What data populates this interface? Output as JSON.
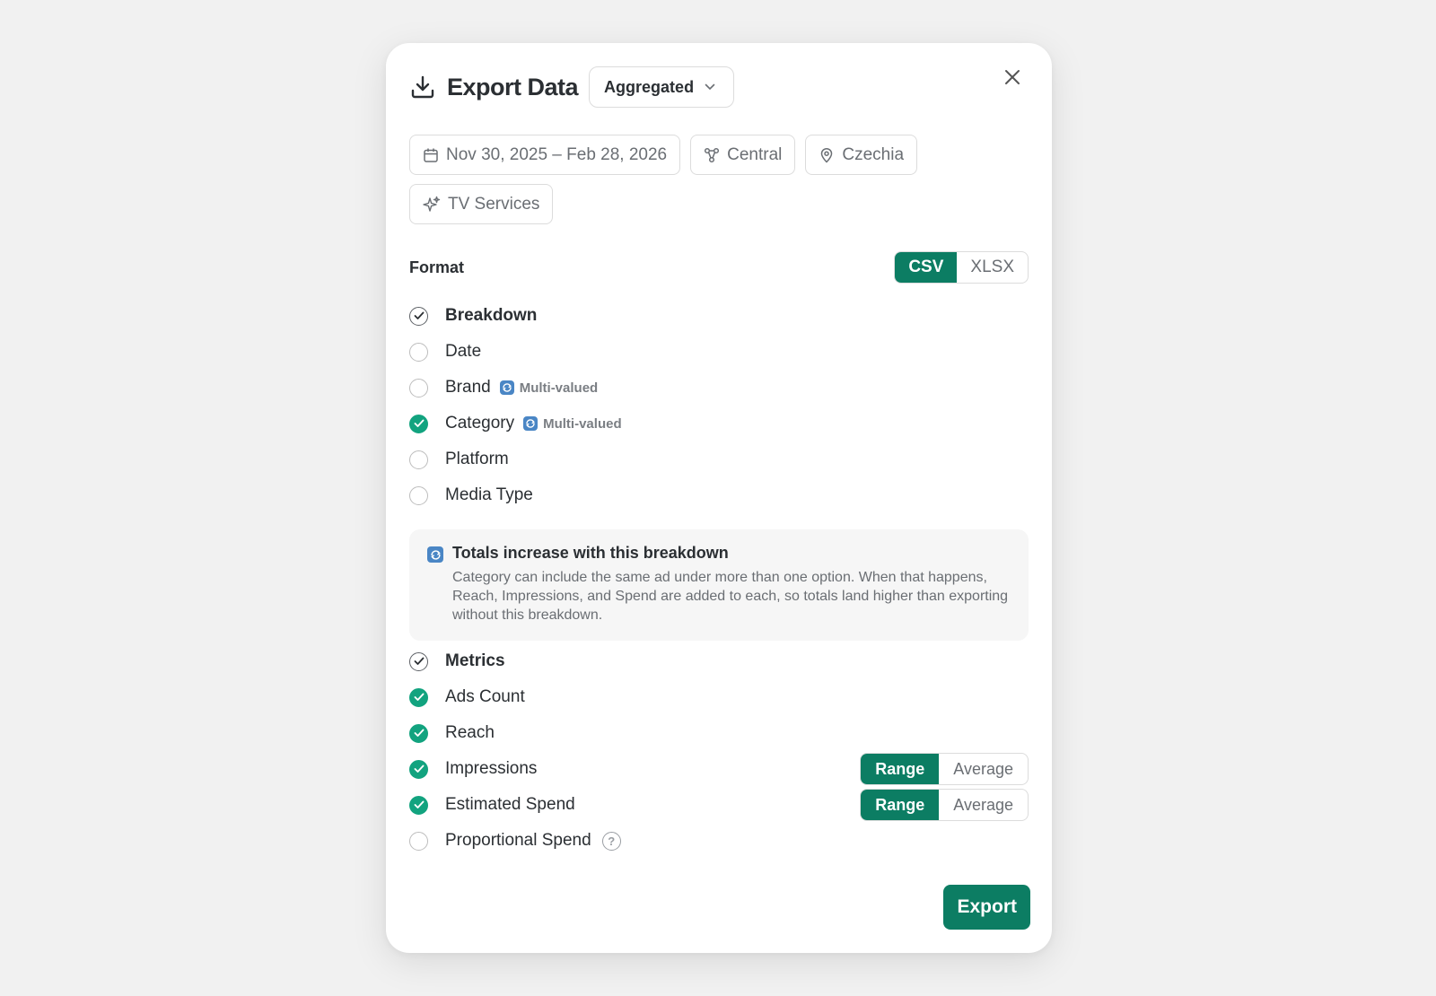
{
  "header": {
    "title": "Export Data",
    "mode_select": "Aggregated"
  },
  "filters": [
    {
      "icon": "calendar-icon",
      "label": "Nov 30, 2025 – Feb 28, 2026"
    },
    {
      "icon": "network-icon",
      "label": "Central"
    },
    {
      "icon": "location-pin-icon",
      "label": "Czechia"
    },
    {
      "icon": "sparkle-icon",
      "label": "TV Services"
    }
  ],
  "format": {
    "label": "Format",
    "options": [
      "CSV",
      "XLSX"
    ],
    "selected": "CSV"
  },
  "breakdown": {
    "label": "Breakdown",
    "items": [
      {
        "label": "Date",
        "checked": false,
        "multi_valued": false
      },
      {
        "label": "Brand",
        "checked": false,
        "multi_valued": true
      },
      {
        "label": "Category",
        "checked": true,
        "multi_valued": true
      },
      {
        "label": "Platform",
        "checked": false,
        "multi_valued": false
      },
      {
        "label": "Media Type",
        "checked": false,
        "multi_valued": false
      }
    ],
    "multi_valued_label": "Multi-valued"
  },
  "info": {
    "title": "Totals increase with this breakdown",
    "text": "Category can include the same ad under more than one option. When that happens, Reach, Impressions, and Spend are added to each, so totals land higher than exporting without this breakdown."
  },
  "metrics": {
    "label": "Metrics",
    "items": [
      {
        "label": "Ads Count",
        "checked": true
      },
      {
        "label": "Reach",
        "checked": true
      },
      {
        "label": "Impressions",
        "checked": true,
        "mode_options": [
          "Range",
          "Average"
        ],
        "mode": "Range"
      },
      {
        "label": "Estimated Spend",
        "checked": true,
        "mode_options": [
          "Range",
          "Average"
        ],
        "mode": "Range"
      },
      {
        "label": "Proportional Spend",
        "checked": false,
        "help": "?"
      }
    ]
  },
  "actions": {
    "export_label": "Export"
  },
  "colors": {
    "accent": "#0c7d63",
    "checkbox_checked": "#12a37f",
    "multi_valued_icon": "#4a86c5"
  }
}
